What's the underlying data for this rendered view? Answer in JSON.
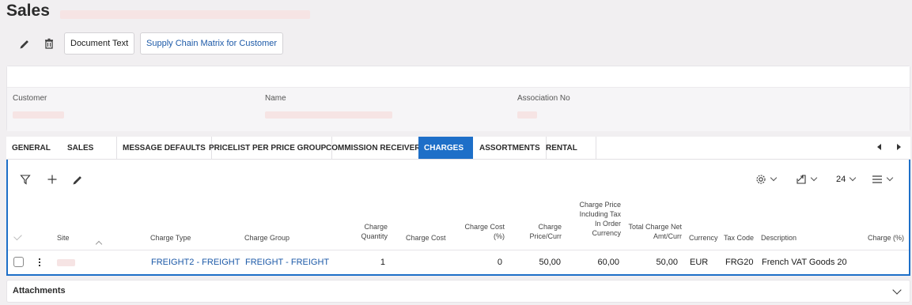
{
  "page": {
    "title": "Sales"
  },
  "toolbar": {
    "document_text_label": "Document Text",
    "supply_chain_label": "Supply Chain Matrix for Customer"
  },
  "header": {
    "customer_label": "Customer",
    "name_label": "Name",
    "association_label": "Association No"
  },
  "tabs": {
    "general": "GENERAL",
    "sales": "SALES",
    "message_defaults": "MESSAGE DEFAULTS",
    "pricelist": "PRICELIST PER PRICE GROUP",
    "commission": "COMMISSION RECEIVER",
    "charges": "CHARGES",
    "assortments": "ASSORTMENTS",
    "rental": "RENTAL",
    "active": "CHARGES"
  },
  "grid_toolbar": {
    "page_size": "24"
  },
  "columns": {
    "site": "Site",
    "charge_type": "Charge Type",
    "charge_group": "Charge Group",
    "charge_quantity_1": "Charge",
    "charge_quantity_2": "Quantity",
    "charge_cost": "Charge Cost",
    "charge_cost_pct_1": "Charge Cost",
    "charge_cost_pct_2": "(%)",
    "charge_price_1": "Charge",
    "charge_price_2": "Price/Curr",
    "incl_tax_1": "Charge Price",
    "incl_tax_2": "Including Tax",
    "incl_tax_3": "In Order",
    "incl_tax_4": "Currency",
    "total_net_1": "Total Charge Net",
    "total_net_2": "Amt/Curr",
    "currency": "Currency",
    "tax_code": "Tax Code",
    "description": "Description",
    "charge_pct": "Charge (%)"
  },
  "rows": [
    {
      "charge_type": "FREIGHT2 - FREIGHT",
      "charge_group": "FREIGHT - FREIGHT",
      "charge_quantity": "1",
      "charge_cost_pct": "0",
      "charge_price": "50,00",
      "incl_tax": "60,00",
      "total_net": "50,00",
      "currency": "EUR",
      "tax_code": "FRG20",
      "description": "French VAT Goods 20"
    }
  ],
  "attachments": {
    "label": "Attachments"
  },
  "colors": {
    "accent": "#1e6fc8",
    "link": "#1d5aa8",
    "skeleton": "#f6e4e4",
    "background": "#f1eff1"
  }
}
